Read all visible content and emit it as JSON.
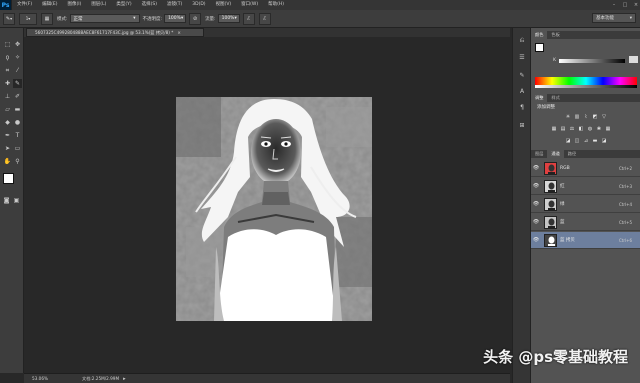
{
  "app": {
    "logo": "Ps"
  },
  "menu": {
    "items": [
      "文件(F)",
      "编辑(E)",
      "图像(I)",
      "图层(L)",
      "类型(Y)",
      "选择(S)",
      "滤镜(T)",
      "3D(D)",
      "视图(V)",
      "窗口(W)",
      "帮助(H)"
    ]
  },
  "window_controls": [
    "–",
    "□",
    "×"
  ],
  "options": {
    "mode_label": "模式:",
    "mode_value": "正常",
    "opacity_label": "不透明度:",
    "opacity_value": "100%",
    "flow_label": "流量:",
    "flow_value": "100%",
    "brush_size": "1"
  },
  "workspace": {
    "label": "基本功能"
  },
  "document": {
    "tab_title": "5607325C4992804888AEC8F61717F43C.jpg @ 53.1%(蓝 拷贝/8) *",
    "close": "×"
  },
  "status": {
    "zoom": "53.06%",
    "doc_info": "文档:2.25M/2.99M"
  },
  "panels": {
    "color_tabs": [
      "颜色",
      "色板"
    ],
    "adjust_tabs": [
      "调整",
      "样式"
    ],
    "adjust_title": "添加调整",
    "layer_tabs": [
      "图层",
      "通道",
      "路径"
    ],
    "channels": [
      {
        "name": "RGB",
        "key": "Ctrl+2",
        "visible": true,
        "selected": false
      },
      {
        "name": "红",
        "key": "Ctrl+3",
        "visible": true,
        "selected": false
      },
      {
        "name": "绿",
        "key": "Ctrl+4",
        "visible": true,
        "selected": false
      },
      {
        "name": "蓝",
        "key": "Ctrl+5",
        "visible": true,
        "selected": false
      },
      {
        "name": "蓝 拷贝",
        "key": "Ctrl+6",
        "visible": true,
        "selected": true
      }
    ]
  },
  "colors": {
    "accent": "#6d7f9e",
    "ps_logo": "#31a8ff",
    "foreground": "#ffffff",
    "background": "#000000"
  },
  "watermark": "头条 @ps零基础教程"
}
